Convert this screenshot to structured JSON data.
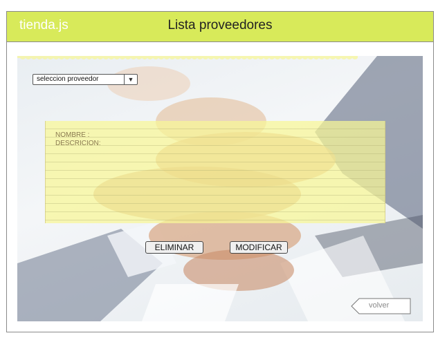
{
  "header": {
    "brand": "tienda.js",
    "title": "Lista proveedores"
  },
  "select": {
    "value": "seleccion proveedor",
    "arrow_icon": "triangle-down"
  },
  "note": {
    "line1": "NOMBRE :",
    "line2": "DESCRICION:"
  },
  "buttons": {
    "delete": "ELIMINAR",
    "modify": "MODIFICAR",
    "back": "volver"
  },
  "colors": {
    "header_bg": "#d8ea5a",
    "note_bg": "#f8f696"
  }
}
